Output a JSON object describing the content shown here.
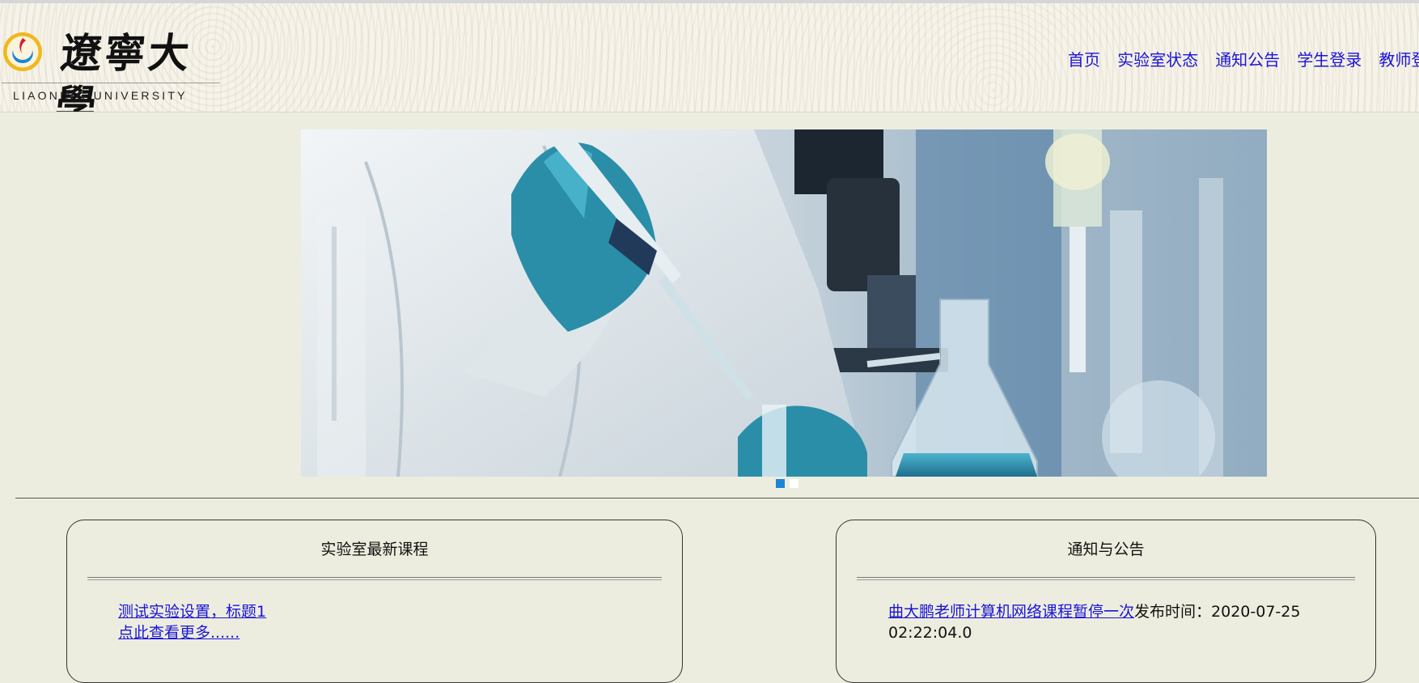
{
  "header": {
    "logo_cn": "遼寧大學",
    "logo_en": "LIAONING UNIVERSITY",
    "nav": [
      "首页",
      "实验室状态",
      "通知公告",
      "学生登录",
      "教师登录"
    ]
  },
  "colors": {
    "link": "#1b15d6",
    "page_bg": "#ededdf",
    "dot_active": "#1a86d6",
    "dot_inactive": "#ffffff"
  },
  "banner": {
    "image": "laboratory-photo",
    "slides": 2,
    "active_slide": 1
  },
  "courses": {
    "title": "实验室最新课程",
    "items": [
      "测试实验设置，标题1"
    ],
    "more": "点此查看更多......"
  },
  "notices": {
    "title": "通知与公告",
    "items": [
      {
        "title": "曲大鹏老师计算机网络课程暂停一次",
        "time_label": "发布时间：",
        "time": "2020-07-25 02:22:04.0"
      }
    ]
  }
}
